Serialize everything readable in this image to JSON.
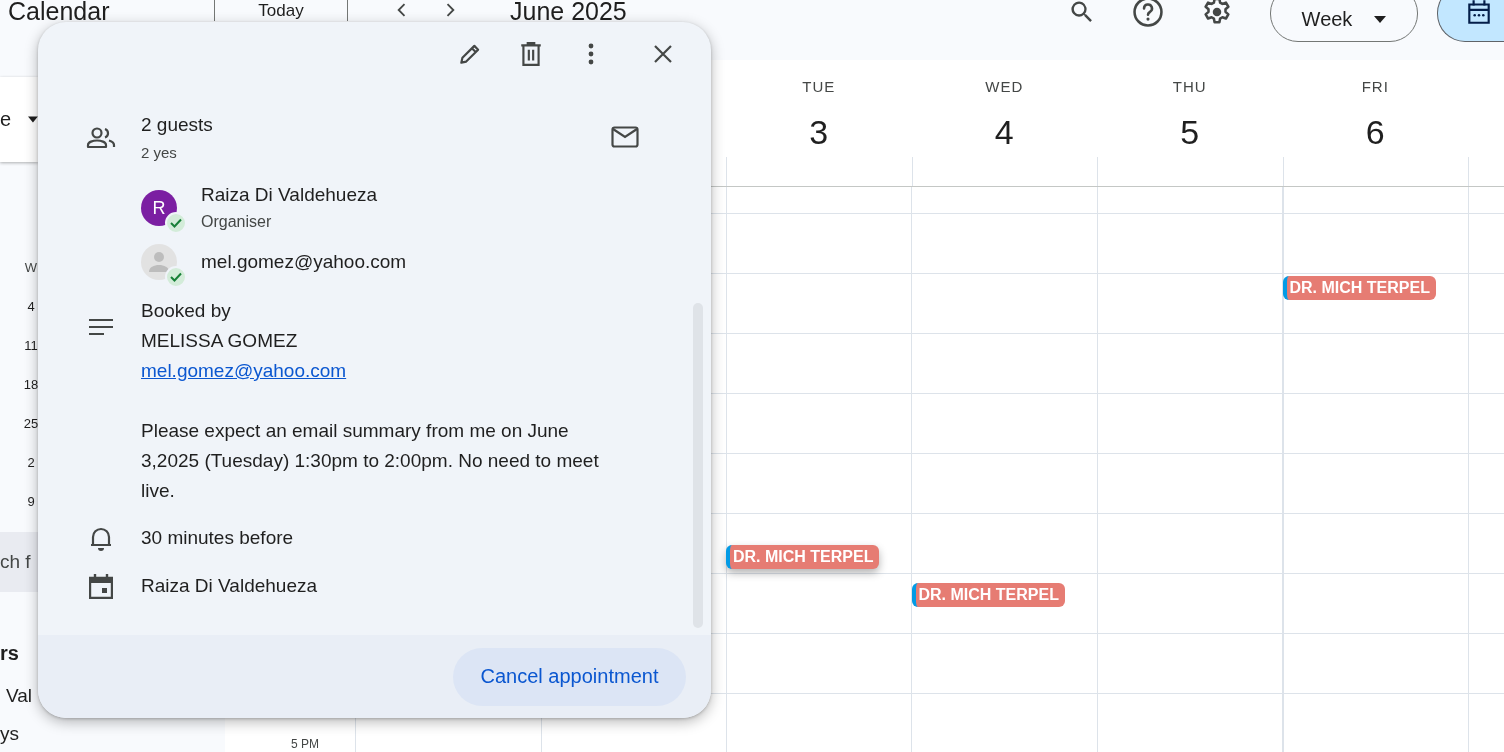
{
  "app": {
    "title": "Calendar"
  },
  "toolbar": {
    "today": "Today",
    "period": "June 2025",
    "view": "Week"
  },
  "sidebar": {
    "create_label": "e",
    "mini_calendar": {
      "header": "W",
      "days": [
        "4",
        "11",
        "18",
        "25",
        "2",
        "9"
      ]
    },
    "search": "ch f",
    "section": "rs",
    "items": [
      "Val",
      "ys"
    ]
  },
  "week": {
    "time_label": "5 PM",
    "days": [
      {
        "name": "TUE",
        "date": "3",
        "events": [
          {
            "title": "DR. MICH TERPEL",
            "selected": true
          }
        ]
      },
      {
        "name": "WED",
        "date": "4",
        "events": [
          {
            "title": "DR. MICH TERPEL",
            "selected": false
          }
        ]
      },
      {
        "name": "THU",
        "date": "5"
      },
      {
        "name": "FRI",
        "date": "6",
        "events": [
          {
            "title": "DR. MICH TERPEL",
            "selected": false
          }
        ]
      }
    ]
  },
  "popup": {
    "guests": {
      "title": "2 guests",
      "summary": "2 yes",
      "list": [
        {
          "kind": "initial",
          "initial": "R",
          "name": "Raiza Di Valdehueza",
          "role": "Organiser",
          "accepted": true
        },
        {
          "kind": "silhouette",
          "name": "mel.gomez@yahoo.com",
          "accepted": true
        }
      ]
    },
    "description": {
      "heading": "Booked by",
      "name": "MELISSA GOMEZ",
      "email": "mel.gomez@yahoo.com",
      "note": "Please expect an email summary from me on June 3,2025 (Tuesday) 1:30pm to 2:00pm. No need to meet live."
    },
    "reminder": "30 minutes before",
    "calendar": "Raiza Di Valdehueza",
    "action": "Cancel appointment"
  }
}
